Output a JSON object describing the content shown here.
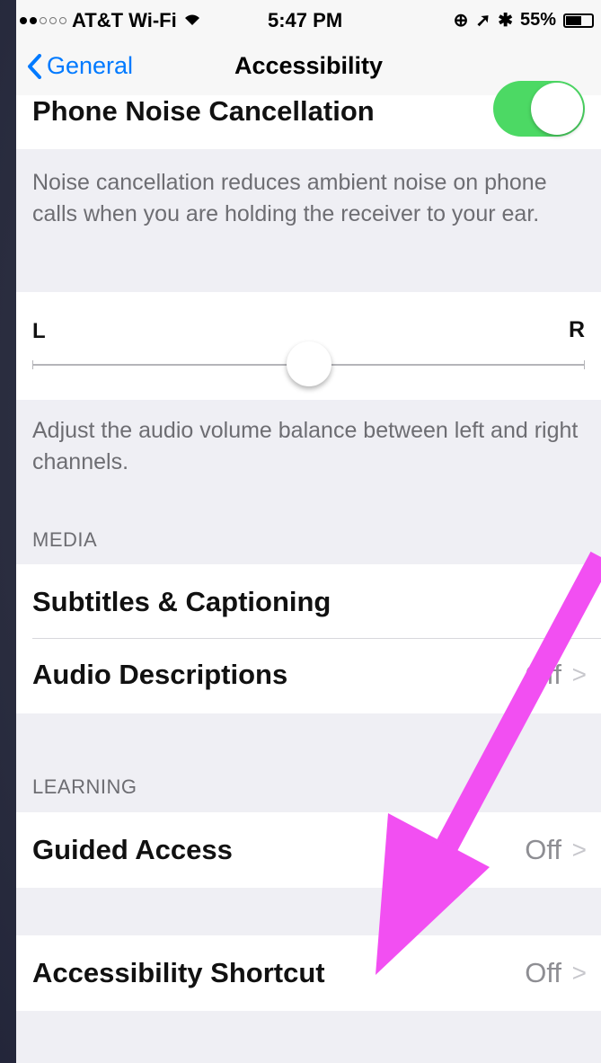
{
  "status": {
    "carrier": "AT&T Wi-Fi",
    "time": "5:47 PM",
    "battery": "55%",
    "battery_level": 0.55
  },
  "nav": {
    "back_label": "General",
    "title": "Accessibility"
  },
  "noise": {
    "label": "Phone Noise Cancellation",
    "toggle_on": true,
    "footer": "Noise cancellation reduces ambient noise on phone calls when you are holding the receiver to your ear."
  },
  "balance": {
    "left_label": "L",
    "right_label": "R",
    "value": 0.5,
    "footer": "Adjust the audio volume balance between left and right channels."
  },
  "media": {
    "header": "MEDIA",
    "items": [
      {
        "label": "Subtitles & Captioning",
        "value": ""
      },
      {
        "label": "Audio Descriptions",
        "value": "Off"
      }
    ]
  },
  "learning": {
    "header": "LEARNING",
    "items": [
      {
        "label": "Guided Access",
        "value": "Off"
      }
    ]
  },
  "shortcut": {
    "label": "Accessibility Shortcut",
    "value": "Off"
  },
  "colors": {
    "accent": "#007aff",
    "toggle_on": "#4cd964",
    "annotation_arrow": "#f24ff2"
  }
}
